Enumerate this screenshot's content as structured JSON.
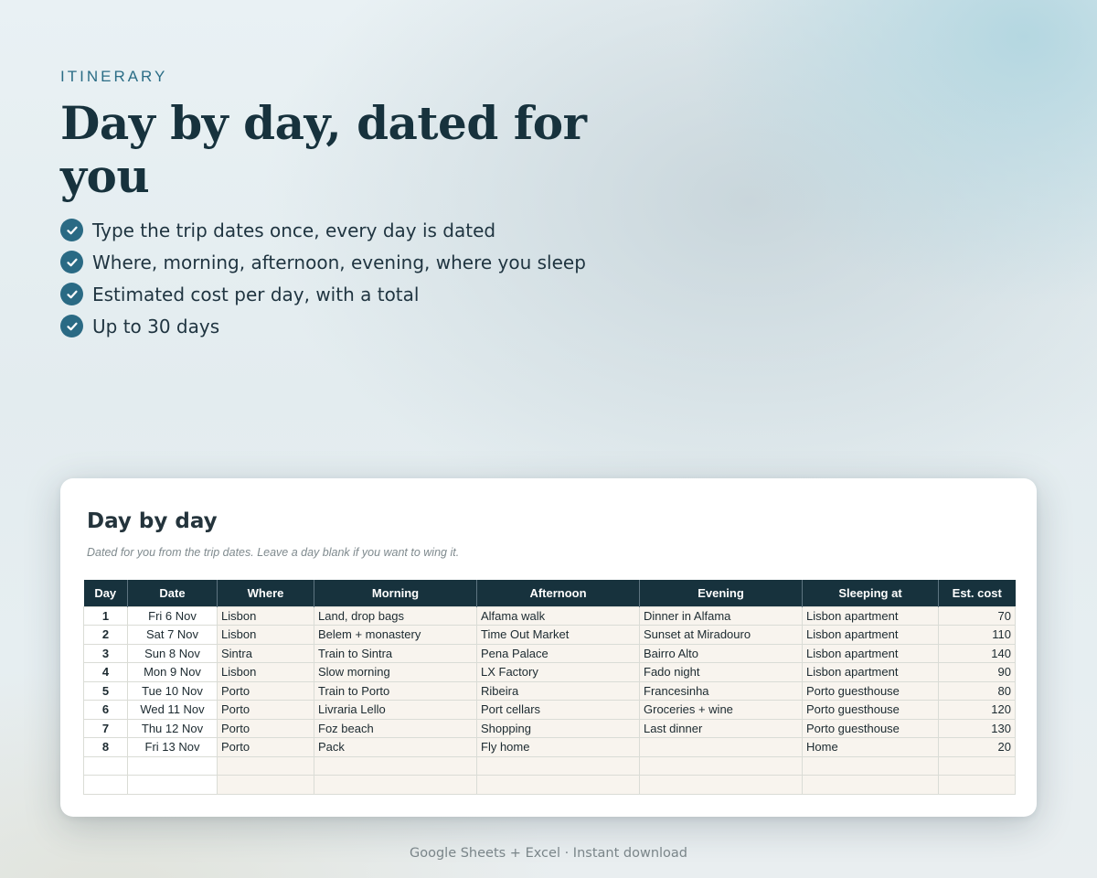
{
  "hero": {
    "eyebrow": "ITINERARY",
    "headline": "Day by day, dated for you",
    "features": [
      {
        "icon": "check-icon",
        "text": "Type the trip dates once, every day is dated"
      },
      {
        "icon": "check-icon",
        "text": "Where, morning, afternoon, evening, where you sleep"
      },
      {
        "icon": "check-icon",
        "text": "Estimated cost per day, with a total"
      },
      {
        "icon": "check-icon",
        "text": "Up to 30 days"
      }
    ]
  },
  "sheet": {
    "title": "Day by day",
    "subtitle": "Dated for you from the trip dates. Leave a day blank if you want to wing it.",
    "headers": [
      "Day",
      "Date",
      "Where",
      "Morning",
      "Afternoon",
      "Evening",
      "Sleeping at",
      "Est. cost"
    ],
    "rows": [
      {
        "day": "1",
        "date": "Fri 6 Nov",
        "where": "Lisbon",
        "morning": "Land, drop bags",
        "afternoon": "Alfama walk",
        "evening": "Dinner in Alfama",
        "sleeping": "Lisbon apartment",
        "cost": "70"
      },
      {
        "day": "2",
        "date": "Sat 7 Nov",
        "where": "Lisbon",
        "morning": "Belem + monastery",
        "afternoon": "Time Out Market",
        "evening": "Sunset at Miradouro",
        "sleeping": "Lisbon apartment",
        "cost": "110"
      },
      {
        "day": "3",
        "date": "Sun 8 Nov",
        "where": "Sintra",
        "morning": "Train to Sintra",
        "afternoon": "Pena Palace",
        "evening": "Bairro Alto",
        "sleeping": "Lisbon apartment",
        "cost": "140"
      },
      {
        "day": "4",
        "date": "Mon 9 Nov",
        "where": "Lisbon",
        "morning": "Slow morning",
        "afternoon": "LX Factory",
        "evening": "Fado night",
        "sleeping": "Lisbon apartment",
        "cost": "90"
      },
      {
        "day": "5",
        "date": "Tue 10 Nov",
        "where": "Porto",
        "morning": "Train to Porto",
        "afternoon": "Ribeira",
        "evening": "Francesinha",
        "sleeping": "Porto guesthouse",
        "cost": "80"
      },
      {
        "day": "6",
        "date": "Wed 11 Nov",
        "where": "Porto",
        "morning": "Livraria Lello",
        "afternoon": "Port cellars",
        "evening": "Groceries + wine",
        "sleeping": "Porto guesthouse",
        "cost": "120"
      },
      {
        "day": "7",
        "date": "Thu 12 Nov",
        "where": "Porto",
        "morning": "Foz beach",
        "afternoon": "Shopping",
        "evening": "Last dinner",
        "sleeping": "Porto guesthouse",
        "cost": "130"
      },
      {
        "day": "8",
        "date": "Fri 13 Nov",
        "where": "Porto",
        "morning": "Pack",
        "afternoon": "Fly home",
        "evening": "",
        "sleeping": "Home",
        "cost": "20"
      },
      {
        "day": "",
        "date": "",
        "where": "",
        "morning": "",
        "afternoon": "",
        "evening": "",
        "sleeping": "",
        "cost": ""
      },
      {
        "day": "",
        "date": "",
        "where": "",
        "morning": "",
        "afternoon": "",
        "evening": "",
        "sleeping": "",
        "cost": ""
      }
    ]
  },
  "footer": {
    "text": "Google Sheets + Excel  ·  Instant download"
  },
  "colors": {
    "accent": "#2a6a84",
    "header_bg": "#17323d",
    "cell_fill": "#f8f4ee"
  }
}
